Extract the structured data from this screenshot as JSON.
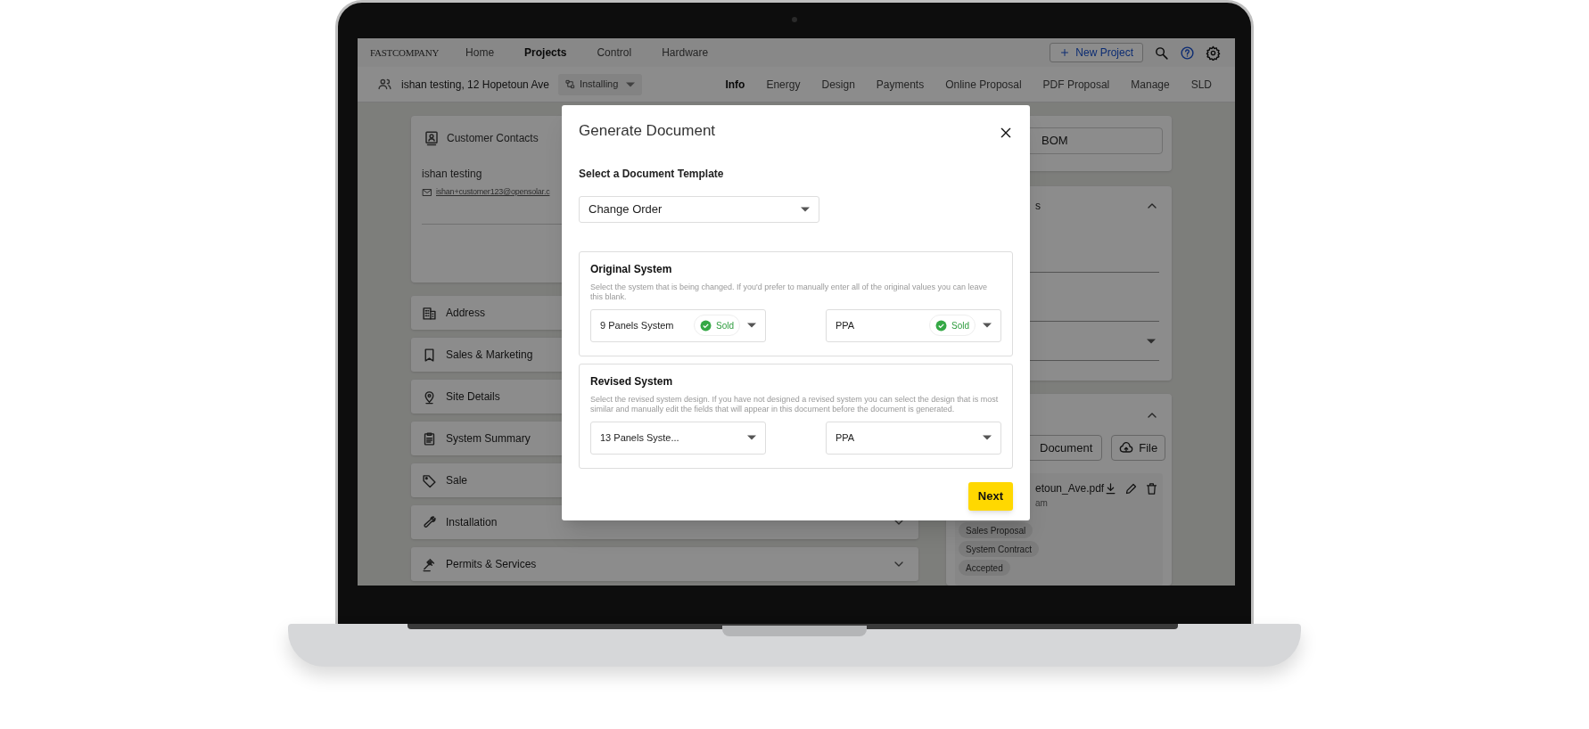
{
  "app_bar": {
    "logo": "FASTCOMPANY",
    "nav": [
      {
        "label": "Home",
        "selected": false
      },
      {
        "label": "Projects",
        "selected": true
      },
      {
        "label": "Control",
        "selected": false
      },
      {
        "label": "Hardware",
        "selected": false
      }
    ],
    "new_project_button": "New Project"
  },
  "project_bar": {
    "project": "ishan testing, 12 Hopetoun Ave",
    "stage": "Installing",
    "tabs": [
      {
        "label": "Info",
        "selected": true
      },
      {
        "label": "Energy",
        "selected": false
      },
      {
        "label": "Design",
        "selected": false
      },
      {
        "label": "Payments",
        "selected": false
      },
      {
        "label": "Online Proposal",
        "selected": false
      },
      {
        "label": "PDF Proposal",
        "selected": false
      },
      {
        "label": "Manage",
        "selected": false
      },
      {
        "label": "SLD",
        "selected": false
      }
    ]
  },
  "customer_contacts": {
    "title": "Customer Contacts",
    "name": "ishan testing",
    "email": "ishan+customer123@opensolar.c"
  },
  "sections": [
    {
      "label": "Address"
    },
    {
      "label": "Sales & Marketing"
    },
    {
      "label": "Site Details"
    },
    {
      "label": "System Summary"
    },
    {
      "label": "Sale"
    },
    {
      "label": "Installation"
    },
    {
      "label": "Permits & Services"
    }
  ],
  "right_panel": {
    "bom_field": "BOM",
    "details_card": {
      "title": "s",
      "expanded": true
    },
    "documents_card": {
      "expanded": true,
      "buttons": [
        "Document",
        "File"
      ],
      "file": {
        "name": "etoun_Ave.pdf",
        "meta": "am",
        "tags": [
          "Sales Proposal",
          "System Contract",
          "Accepted"
        ]
      }
    }
  },
  "dialog": {
    "title": "Generate Document",
    "template_label": "Select a Document Template",
    "template": "Change Order",
    "sections": [
      {
        "title": "Original System",
        "description": "Select the system that is being changed. If you'd prefer to manually enter all of the original values you can leave this blank.",
        "selects": [
          {
            "value": "9 Panels System",
            "status": "Sold"
          },
          {
            "value": "PPA",
            "status": "Sold"
          }
        ]
      },
      {
        "title": "Revised System",
        "description": "Select the revised system design. If you have not designed a revised system you can select the design that is most similar and manually edit the fields that will appear in this document before the document is generated.",
        "selects": [
          {
            "value": "13 Panels Syste..."
          },
          {
            "value": "PPA"
          }
        ]
      }
    ],
    "next_button": "Next"
  }
}
